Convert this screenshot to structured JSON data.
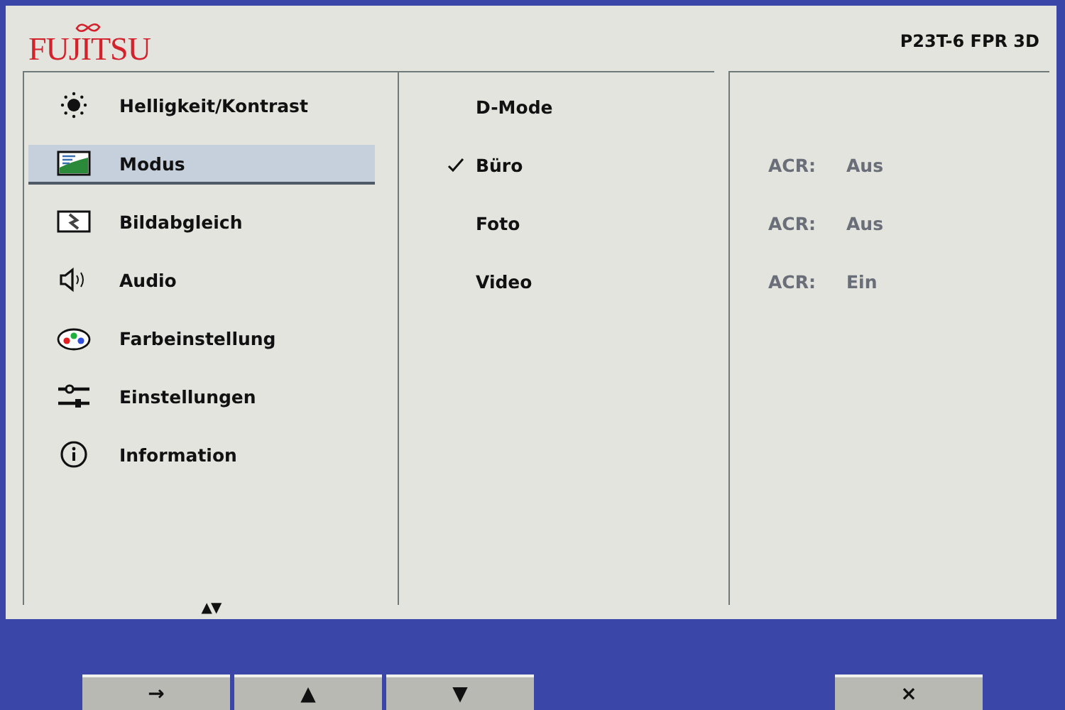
{
  "brand": {
    "logo": "FUJITSU"
  },
  "model": "P23T-6 FPR 3D",
  "menu": [
    {
      "label": "Helligkeit/Kontrast",
      "kind": "brightness",
      "selected": false
    },
    {
      "label": "Modus",
      "kind": "mode",
      "selected": true
    },
    {
      "label": "Bildabgleich",
      "kind": "adjust",
      "selected": false
    },
    {
      "label": "Audio",
      "kind": "audio",
      "selected": false
    },
    {
      "label": "Farbeinstellung",
      "kind": "color",
      "selected": false
    },
    {
      "label": "Einstellungen",
      "kind": "settings",
      "selected": false
    },
    {
      "label": "Information",
      "kind": "info",
      "selected": false
    }
  ],
  "scroll_indicator": "▲▼",
  "modes": [
    {
      "label": "D-Mode",
      "checked": false
    },
    {
      "label": "Büro",
      "checked": true,
      "acr_label": "ACR:",
      "acr_value": "Aus"
    },
    {
      "label": "Foto",
      "checked": false,
      "acr_label": "ACR:",
      "acr_value": "Aus"
    },
    {
      "label": "Video",
      "checked": false,
      "acr_label": "ACR:",
      "acr_value": "Ein"
    }
  ],
  "buttons": [
    {
      "label": "→",
      "kind": "nav"
    },
    {
      "label": "▲",
      "kind": "nav"
    },
    {
      "label": "▼",
      "kind": "nav"
    },
    {
      "label": "×",
      "kind": "close"
    }
  ]
}
